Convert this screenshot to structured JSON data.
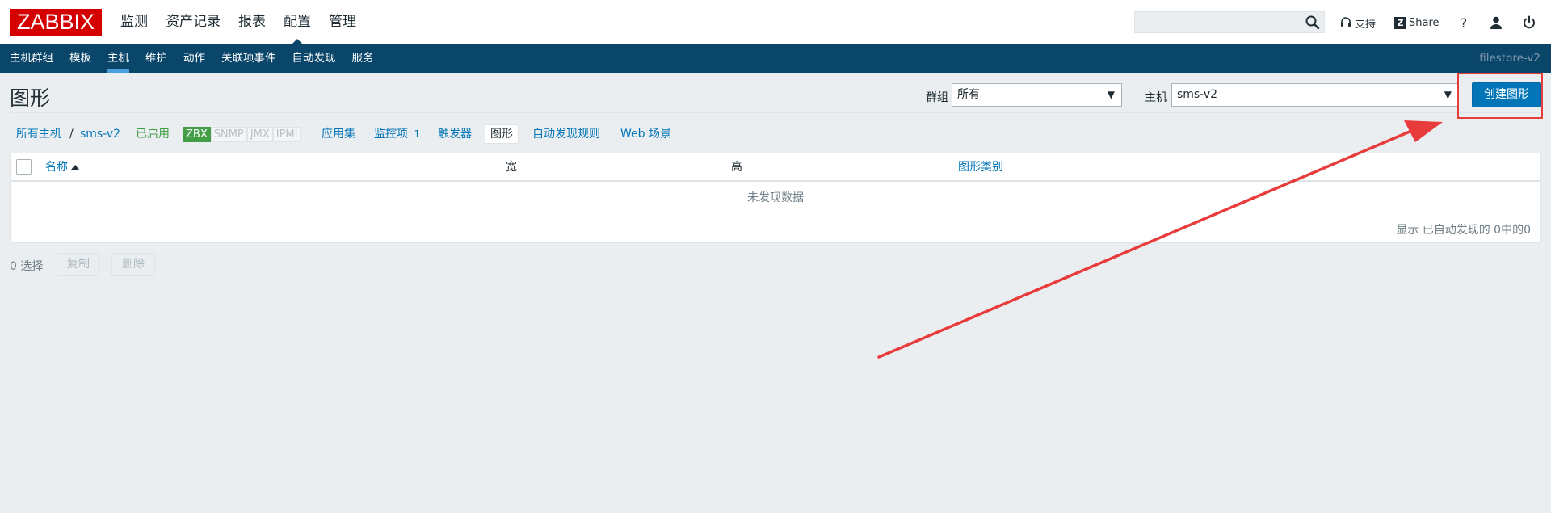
{
  "logo": "ZABBIX",
  "main_menu": [
    {
      "label": "监测"
    },
    {
      "label": "资产记录"
    },
    {
      "label": "报表"
    },
    {
      "label": "配置",
      "active": true
    },
    {
      "label": "管理"
    }
  ],
  "header": {
    "search_placeholder": "",
    "support_label": "支持",
    "share_label": "Share",
    "help_label": "?"
  },
  "sub_menu": [
    {
      "label": "主机群组"
    },
    {
      "label": "模板"
    },
    {
      "label": "主机",
      "active": true
    },
    {
      "label": "维护"
    },
    {
      "label": "动作"
    },
    {
      "label": "关联项事件"
    },
    {
      "label": "自动发现"
    },
    {
      "label": "服务"
    }
  ],
  "server_name": "filestore-v2",
  "page": {
    "title": "图形",
    "group_label": "群组",
    "group_value": "所有",
    "host_label": "主机",
    "host_value": "sms-v2",
    "create_button": "创建图形"
  },
  "host_nav": {
    "all_hosts": "所有主机",
    "separator": "/",
    "host": "sms-v2",
    "status": "已启用",
    "availability": [
      "ZBX",
      "SNMP",
      "JMX",
      "IPMI"
    ],
    "apps": "应用集",
    "items": "监控项",
    "items_count": "1",
    "triggers": "触发器",
    "graphs": "图形",
    "discovery": "自动发现规则",
    "web": "Web 场景"
  },
  "table": {
    "columns": [
      "名称",
      "宽",
      "高",
      "图形类别"
    ],
    "empty": "未发现数据",
    "stats": "显示 已自动发现的 0中的0"
  },
  "actions": {
    "selected": "0 选择",
    "copy": "复制",
    "delete": "删除"
  },
  "colors": {
    "header_bg": "#0a466a",
    "accent": "#0275b8",
    "enabled": "#429e47",
    "annotation": "#e83b3b"
  }
}
